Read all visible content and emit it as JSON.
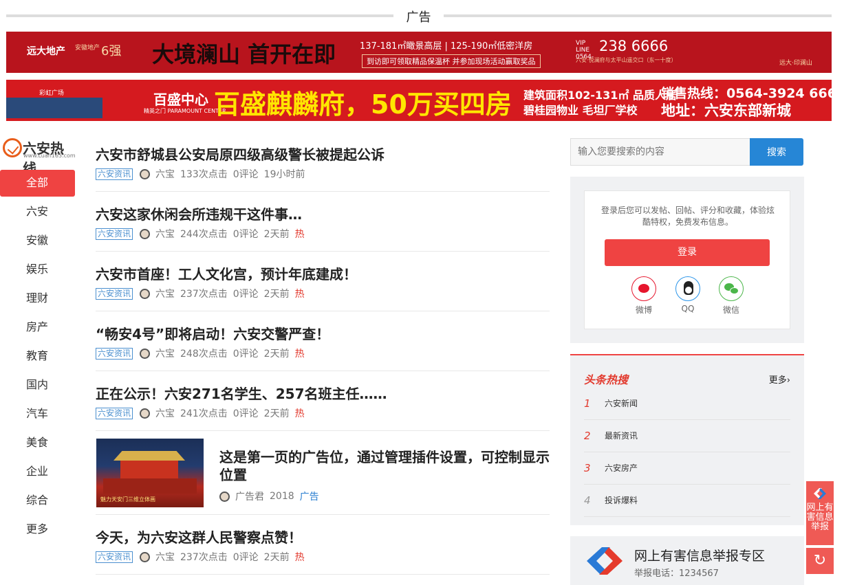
{
  "ad_header": {
    "label": "广告"
  },
  "banner1": {
    "brand": "远大地产",
    "rank_small": "安徽地产",
    "rank": "6强",
    "slogan": "大境澜山 首开在即",
    "line1": "137-181㎡瞰景高层 | 125-190㎡低密洋房",
    "line2": "到访即可领取精品保温杯 并参加现场活动赢取奖品",
    "vip": "VIP LINE 0564-",
    "phone": "238 6666",
    "addr": "六安·悦澜府与太平山遥交口（东一十度）",
    "brand2": "远大·印澜山",
    "colors": {
      "bg": "#b8141d",
      "text": "#ffffff"
    }
  },
  "banner2": {
    "tag": "彩虹广场",
    "center": "百盛中心",
    "center_sub": "精英之门 PARAMOUNT CENTER",
    "headline": "百盛麒麟府，50万买四房",
    "spec1": "建筑面积102-131㎡ 品质人居",
    "spec2": "碧桂园物业 毛坦厂学校",
    "hotline": "销售热线：0564-3924 666",
    "address": "地址：六安东部新城",
    "colors": {
      "bg": "#d51a1f",
      "headline": "#ffe600"
    }
  },
  "logo": {
    "name": "六安热线",
    "url": "www.Luan163.com"
  },
  "nav": [
    "全部",
    "六安",
    "安徽",
    "娱乐",
    "理财",
    "房产",
    "教育",
    "国内",
    "汽车",
    "美食",
    "企业",
    "综合",
    "更多"
  ],
  "articles": [
    {
      "title": "六安市舒城县公安局原四级高级警长被提起公诉",
      "tag": "六安资讯",
      "author": "六宝",
      "clicks": "133次点击",
      "comments": "0评论",
      "time": "19小时前",
      "hot": ""
    },
    {
      "title": "六安这家休闲会所违规干这件事…",
      "tag": "六安资讯",
      "author": "六宝",
      "clicks": "244次点击",
      "comments": "0评论",
      "time": "2天前",
      "hot": "热"
    },
    {
      "title": "六安市首座！工人文化宫，预计年底建成！",
      "tag": "六安资讯",
      "author": "六宝",
      "clicks": "237次点击",
      "comments": "0评论",
      "time": "2天前",
      "hot": "热"
    },
    {
      "title": "“畅安4号”即将启动！六安交警严查！",
      "tag": "六安资讯",
      "author": "六宝",
      "clicks": "248次点击",
      "comments": "0评论",
      "time": "2天前",
      "hot": "热"
    },
    {
      "title": "正在公示！六安271名学生、257名班主任……",
      "tag": "六安资讯",
      "author": "六宝",
      "clicks": "241次点击",
      "comments": "0评论",
      "time": "2天前",
      "hot": "热"
    }
  ],
  "ad_article": {
    "title": "这是第一页的广告位，通过管理插件设置，可控制显示位置",
    "author": "广告君",
    "year": "2018",
    "label": "广告",
    "thumb_caption": "魅力天安门三维立体画"
  },
  "last_article": {
    "title": "今天，为六安这群人民警察点赞！",
    "tag": "六安资讯",
    "author": "六宝",
    "clicks": "237次点击",
    "comments": "0评论",
    "time": "2天前",
    "hot": "热"
  },
  "search": {
    "placeholder": "输入您要搜索的内容",
    "button": "搜索"
  },
  "login": {
    "desc": "登录后您可以发帖、回帖、评分和收藏，体验炫酷特权，免费发布信息。",
    "button": "登录",
    "social": [
      {
        "label": "微博",
        "icon": "weibo-icon"
      },
      {
        "label": "QQ",
        "icon": "qq-icon"
      },
      {
        "label": "微信",
        "icon": "wechat-icon"
      }
    ]
  },
  "hot_search": {
    "title": "头条热搜",
    "more": "更多›",
    "items": [
      {
        "n": "1",
        "label": "六安新闻"
      },
      {
        "n": "2",
        "label": "最新资讯"
      },
      {
        "n": "3",
        "label": "六安房产"
      },
      {
        "n": "4",
        "label": "投诉爆料"
      }
    ]
  },
  "report": {
    "title": "网上有害信息举报专区",
    "phone": "举报电话：1234567"
  },
  "float_report": {
    "label": "网上有害信息举报"
  },
  "float_refresh": {
    "label": "↻"
  }
}
